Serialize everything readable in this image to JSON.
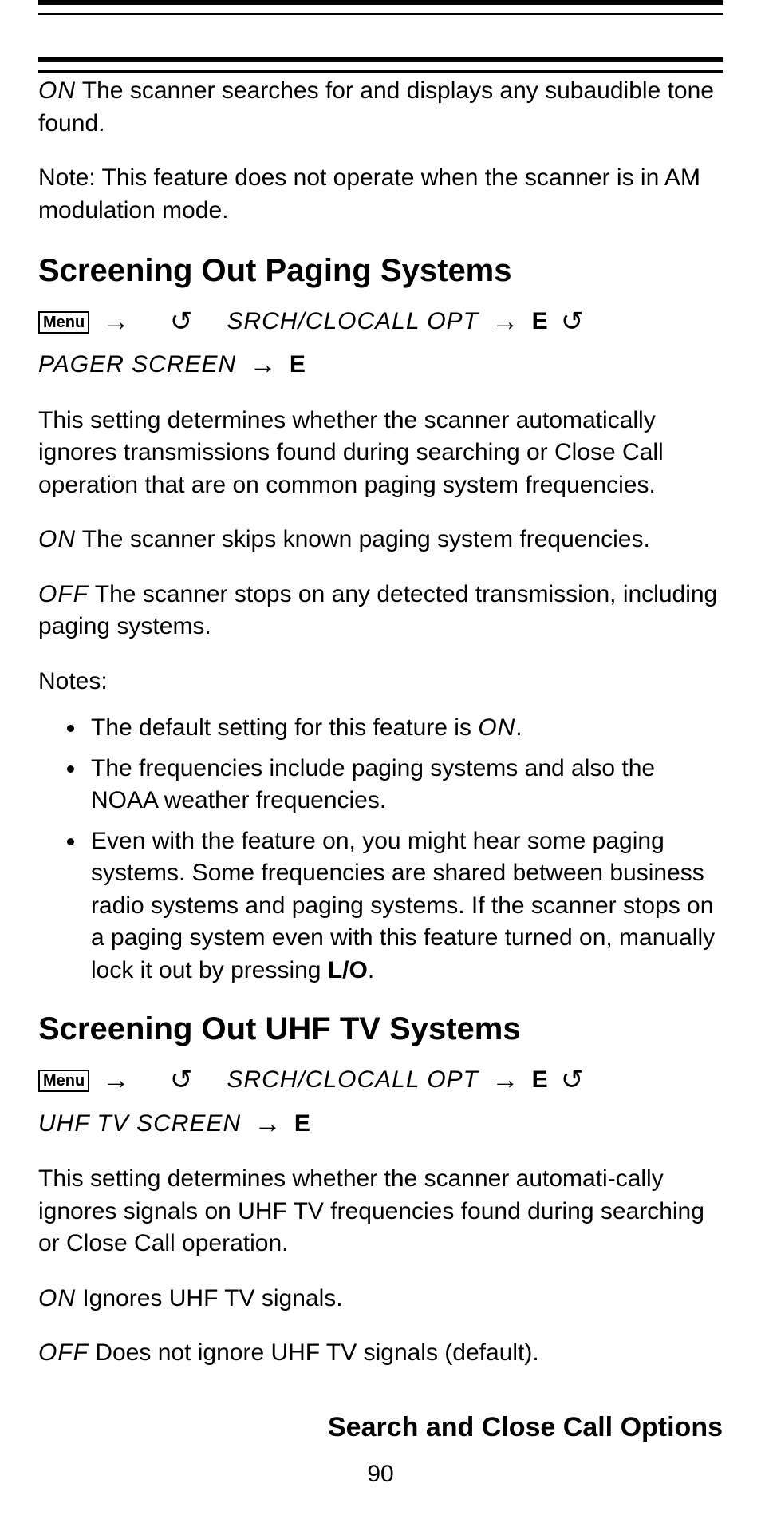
{
  "topPara": {
    "onLabel": "ON",
    "text": " The scanner searches for and displays any subaudible tone found."
  },
  "notePara": "Note: This feature does not operate when the scanner is in AM modulation mode.",
  "section1": {
    "title": "Screening Out Paging Systems",
    "nav": {
      "menu": "Menu",
      "opt": "SRCH/CLOCALL OPT",
      "e": "E",
      "line2": "PAGER SCREEN",
      "e2": "E"
    },
    "desc": "This setting determines whether the scanner automatically ignores transmissions found during searching or Close Call operation that are on common paging system frequencies.",
    "onLabel": "ON",
    "onText": "  The scanner skips known paging system frequencies.",
    "offLabel": "OFF",
    "offText": " The scanner stops on any detected transmission, including paging systems.",
    "notesLabel": "Notes:",
    "bullets": {
      "b1a": "The default setting for this feature is ",
      "b1on": "ON",
      "b1b": ".",
      "b2": "The frequencies include paging systems and also the NOAA weather frequencies.",
      "b3a": "Even with the feature on, you might hear some paging systems. Some frequencies are shared between business radio systems and paging systems. If the scanner stops on a paging system even with this feature turned on, manually lock it out by pressing ",
      "b3lo": "L/O",
      "b3b": "."
    }
  },
  "section2": {
    "title": "Screening Out UHF TV Systems",
    "nav": {
      "menu": "Menu",
      "opt": "SRCH/CLOCALL OPT",
      "e": "E",
      "line2": "UHF TV SCREEN",
      "e2": "E"
    },
    "desc": "This setting determines whether the scanner automati-cally ignores signals on UHF TV frequencies found during searching or Close Call operation.",
    "onLabel": "ON",
    "onText": "  Ignores UHF TV signals.",
    "offLabel": "OFF",
    "offText": " Does not ignore UHF TV signals (default)."
  },
  "chapter": "Search and Close Call Options",
  "pageNumber": "90",
  "glyphs": {
    "arrow": "→",
    "rotate": "↻"
  }
}
